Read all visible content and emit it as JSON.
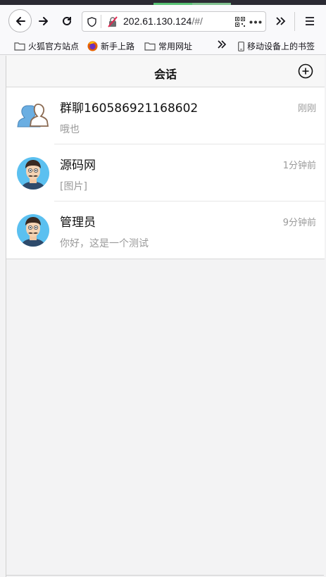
{
  "browser": {
    "url_host": "202.61.130.124",
    "url_path": "/#/",
    "bookmarks": [
      {
        "label": "火狐官方站点",
        "icon": "folder-icon"
      },
      {
        "label": "新手上路",
        "icon": "firefox-icon"
      },
      {
        "label": "常用网址",
        "icon": "folder-icon"
      },
      {
        "label": "移动设备上的书签",
        "icon": "mobile-icon"
      }
    ]
  },
  "header": {
    "title": "会话",
    "add_icon": "plus-circle-icon"
  },
  "conversations": [
    {
      "name": "群聊160586921168602",
      "time": "刚刚",
      "message": "哦也",
      "avatar": "group-avatar-icon"
    },
    {
      "name": "源码网",
      "time": "1分钟前",
      "message": "[图片]",
      "avatar": "man-avatar-icon"
    },
    {
      "name": "管理员",
      "time": "9分钟前",
      "message": "你好，这是一个测试",
      "avatar": "man-avatar-icon"
    }
  ],
  "colors": {
    "tab_accent": "#58c174",
    "header_bg": "#f7f7f7",
    "muted_text": "#999999"
  }
}
